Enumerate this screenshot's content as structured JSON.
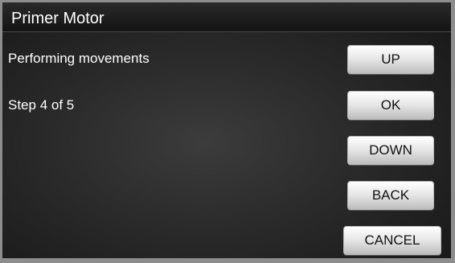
{
  "header": {
    "title": "Primer Motor"
  },
  "messages": {
    "status": "Performing movements",
    "step": "Step 4 of 5"
  },
  "buttons": {
    "up": "UP",
    "ok": "OK",
    "down": "DOWN",
    "back": "BACK",
    "cancel": "CANCEL"
  }
}
